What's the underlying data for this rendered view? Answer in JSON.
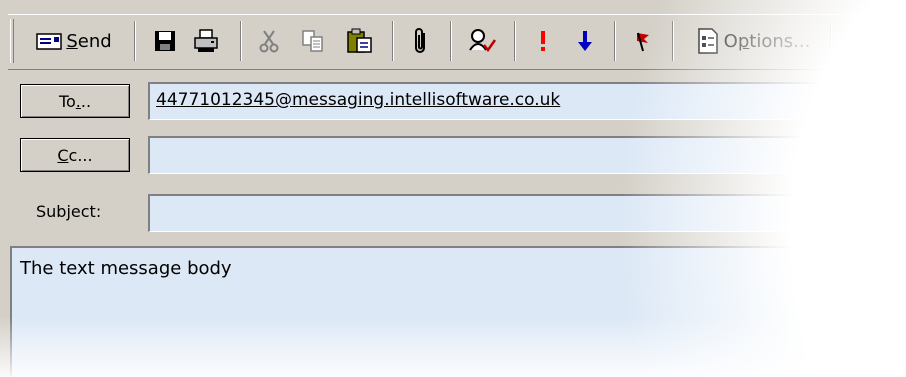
{
  "toolbar": {
    "send_label": "Send",
    "send_mnemonic": "S",
    "send_rest": "end",
    "options_label": "Options...",
    "options_mnemonic": "p",
    "options_before": "O",
    "options_after": "tions...",
    "buttons": [
      {
        "icon": "send-icon"
      },
      {
        "icon": "save-icon"
      },
      {
        "icon": "print-icon"
      },
      {
        "icon": "cut-icon",
        "enabled": false
      },
      {
        "icon": "copy-icon",
        "enabled": false
      },
      {
        "icon": "paste-icon"
      },
      {
        "icon": "attach-icon"
      },
      {
        "icon": "check-names-icon"
      },
      {
        "icon": "importance-high-icon",
        "color": "#ff0000"
      },
      {
        "icon": "importance-low-icon",
        "color": "#0000c0"
      },
      {
        "icon": "flag-icon",
        "color": "#c00000"
      },
      {
        "icon": "options-icon"
      },
      {
        "icon": "help-icon",
        "enabled": false
      }
    ]
  },
  "header": {
    "to_button": "To...",
    "to_before": "To",
    "to_mnemonic": ".",
    "to_after": "..",
    "cc_button": "Cc...",
    "cc_mnemonic": "C",
    "cc_after": "c...",
    "subject_label": "Subject:",
    "subject_before": "Sub",
    "subject_mnemonic": "j",
    "subject_after": "ect:",
    "to_value": "44771012345@messaging.intellisoftware.co.uk",
    "cc_value": "",
    "subject_value": ""
  },
  "body": {
    "text": "The text message body"
  },
  "colors": {
    "chrome": "#d4d0c8",
    "field_background": "#dce8f6"
  }
}
